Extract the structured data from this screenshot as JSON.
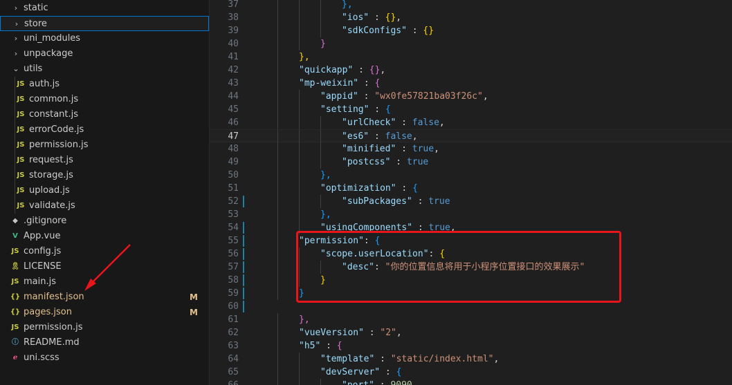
{
  "explorer": {
    "items": [
      {
        "label": "static",
        "type": "folder",
        "expanded": false
      },
      {
        "label": "store",
        "type": "folder",
        "expanded": false,
        "selected": true
      },
      {
        "label": "uni_modules",
        "type": "folder",
        "expanded": false
      },
      {
        "label": "unpackage",
        "type": "folder",
        "expanded": false
      },
      {
        "label": "utils",
        "type": "folder",
        "expanded": true
      },
      {
        "label": "auth.js",
        "type": "js",
        "icon": "JS"
      },
      {
        "label": "common.js",
        "type": "js",
        "icon": "JS"
      },
      {
        "label": "constant.js",
        "type": "js",
        "icon": "JS"
      },
      {
        "label": "errorCode.js",
        "type": "js",
        "icon": "JS"
      },
      {
        "label": "permission.js",
        "type": "js",
        "icon": "JS"
      },
      {
        "label": "request.js",
        "type": "js",
        "icon": "JS"
      },
      {
        "label": "storage.js",
        "type": "js",
        "icon": "JS"
      },
      {
        "label": "upload.js",
        "type": "js",
        "icon": "JS"
      },
      {
        "label": "validate.js",
        "type": "js",
        "icon": "JS"
      },
      {
        "label": ".gitignore",
        "type": "git",
        "icon": "◆"
      },
      {
        "label": "App.vue",
        "type": "vue",
        "icon": "V"
      },
      {
        "label": "config.js",
        "type": "js",
        "icon": "JS"
      },
      {
        "label": "LICENSE",
        "type": "license",
        "icon": "🎗"
      },
      {
        "label": "main.js",
        "type": "js",
        "icon": "JS"
      },
      {
        "label": "manifest.json",
        "type": "json",
        "icon": "{}",
        "badge": "M"
      },
      {
        "label": "pages.json",
        "type": "json",
        "icon": "{}",
        "badge": "M"
      },
      {
        "label": "permission.js",
        "type": "js",
        "icon": "JS"
      },
      {
        "label": "README.md",
        "type": "info",
        "icon": "ⓘ"
      },
      {
        "label": "uni.scss",
        "type": "scss",
        "icon": "ℯ"
      }
    ]
  },
  "editor": {
    "current_line": 47,
    "lines": [
      {
        "n": "37",
        "tokens": [
          [
            "br3",
            "},"
          ]
        ]
      },
      {
        "n": "38",
        "tokens": [
          [
            "key",
            "\"ios\""
          ],
          [
            "punc",
            " : "
          ],
          [
            "br1",
            "{}"
          ],
          [
            "punc",
            ","
          ]
        ]
      },
      {
        "n": "39",
        "tokens": [
          [
            "key",
            "\"sdkConfigs\""
          ],
          [
            "punc",
            " : "
          ],
          [
            "br1",
            "{}"
          ]
        ]
      },
      {
        "n": "40",
        "tokens": [
          [
            "br2",
            "}"
          ]
        ]
      },
      {
        "n": "41",
        "tokens": [
          [
            "br1",
            "},"
          ]
        ]
      },
      {
        "n": "42",
        "tokens": [
          [
            "key",
            "\"quickapp\""
          ],
          [
            "punc",
            " : "
          ],
          [
            "br2",
            "{}"
          ],
          [
            "punc",
            ","
          ]
        ]
      },
      {
        "n": "43",
        "tokens": [
          [
            "key",
            "\"mp-weixin\""
          ],
          [
            "punc",
            " : "
          ],
          [
            "br2",
            "{"
          ]
        ]
      },
      {
        "n": "44",
        "tokens": [
          [
            "key",
            "\"appid\""
          ],
          [
            "punc",
            " : "
          ],
          [
            "str",
            "\"wx0fe57821ba03f26c\""
          ],
          [
            "punc",
            ","
          ]
        ]
      },
      {
        "n": "45",
        "tokens": [
          [
            "key",
            "\"setting\""
          ],
          [
            "punc",
            " : "
          ],
          [
            "br3",
            "{"
          ]
        ]
      },
      {
        "n": "46",
        "tokens": [
          [
            "key",
            "\"urlCheck\""
          ],
          [
            "punc",
            " : "
          ],
          [
            "kw",
            "false"
          ],
          [
            "punc",
            ","
          ]
        ]
      },
      {
        "n": "47",
        "tokens": [
          [
            "key",
            "\"es6\""
          ],
          [
            "punc",
            " : "
          ],
          [
            "kw",
            "false"
          ],
          [
            "punc",
            ","
          ]
        ]
      },
      {
        "n": "48",
        "tokens": [
          [
            "key",
            "\"minified\""
          ],
          [
            "punc",
            " : "
          ],
          [
            "kw",
            "true"
          ],
          [
            "punc",
            ","
          ]
        ]
      },
      {
        "n": "49",
        "tokens": [
          [
            "key",
            "\"postcss\""
          ],
          [
            "punc",
            " : "
          ],
          [
            "kw",
            "true"
          ]
        ]
      },
      {
        "n": "50",
        "tokens": [
          [
            "br3",
            "},"
          ]
        ]
      },
      {
        "n": "51",
        "tokens": [
          [
            "key",
            "\"optimization\""
          ],
          [
            "punc",
            " : "
          ],
          [
            "br3",
            "{"
          ]
        ]
      },
      {
        "n": "52",
        "tokens": [
          [
            "key",
            "\"subPackages\""
          ],
          [
            "punc",
            " : "
          ],
          [
            "kw",
            "true"
          ]
        ]
      },
      {
        "n": "53",
        "tokens": [
          [
            "br3",
            "},"
          ]
        ]
      },
      {
        "n": "54",
        "tokens": [
          [
            "key",
            "\"usingComponents\""
          ],
          [
            "punc",
            " : "
          ],
          [
            "kw",
            "true"
          ],
          [
            "punc",
            ","
          ]
        ]
      },
      {
        "n": "55",
        "tokens": [
          [
            "key",
            "\"permission\""
          ],
          [
            "punc",
            ": "
          ],
          [
            "br3",
            "{"
          ]
        ]
      },
      {
        "n": "56",
        "tokens": [
          [
            "key",
            "\"scope.userLocation\""
          ],
          [
            "punc",
            ": "
          ],
          [
            "br1",
            "{"
          ]
        ]
      },
      {
        "n": "57",
        "tokens": [
          [
            "key",
            "\"desc\""
          ],
          [
            "punc",
            ": "
          ],
          [
            "str",
            "\"你的位置信息将用于小程序位置接口的效果展示\""
          ]
        ]
      },
      {
        "n": "58",
        "tokens": [
          [
            "br1",
            "}"
          ]
        ]
      },
      {
        "n": "59",
        "tokens": [
          [
            "br3",
            "}"
          ]
        ]
      },
      {
        "n": "60",
        "tokens": []
      },
      {
        "n": "61",
        "tokens": [
          [
            "br2",
            "},"
          ]
        ]
      },
      {
        "n": "62",
        "tokens": [
          [
            "key",
            "\"vueVersion\""
          ],
          [
            "punc",
            " : "
          ],
          [
            "str",
            "\"2\""
          ],
          [
            "punc",
            ","
          ]
        ]
      },
      {
        "n": "63",
        "tokens": [
          [
            "key",
            "\"h5\""
          ],
          [
            "punc",
            " : "
          ],
          [
            "br2",
            "{"
          ]
        ]
      },
      {
        "n": "64",
        "tokens": [
          [
            "key",
            "\"template\""
          ],
          [
            "punc",
            " : "
          ],
          [
            "str",
            "\"static/index.html\""
          ],
          [
            "punc",
            ","
          ]
        ]
      },
      {
        "n": "65",
        "tokens": [
          [
            "key",
            "\"devServer\""
          ],
          [
            "punc",
            " : "
          ],
          [
            "br3",
            "{"
          ]
        ]
      },
      {
        "n": "66",
        "tokens": [
          [
            "key",
            "\"port\""
          ],
          [
            "punc",
            " : "
          ],
          [
            "num",
            "9090"
          ],
          [
            "punc",
            ","
          ]
        ]
      }
    ]
  },
  "annotation": {
    "highlight_color": "#e8151a",
    "arrow_color": "#e8151a"
  }
}
